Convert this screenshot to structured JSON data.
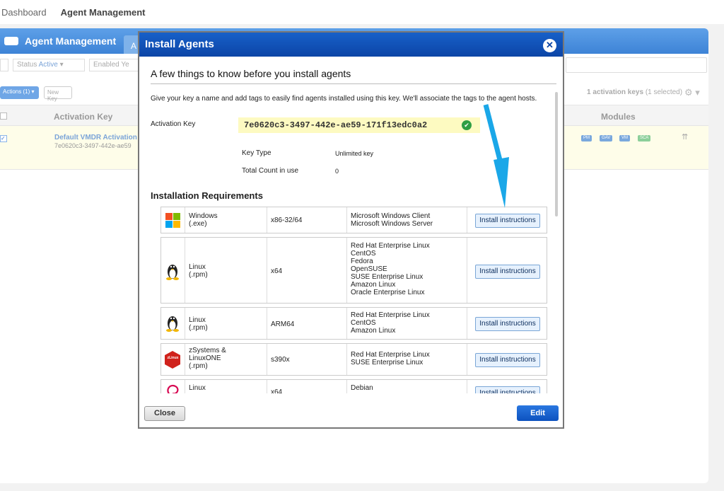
{
  "breadcrumb": {
    "home": "Dashboard",
    "current": "Agent Management"
  },
  "panel": {
    "title": "Agent Management",
    "tab_label": "A",
    "filters": [
      {
        "label": "Status",
        "value": "Active"
      },
      {
        "label": "Enabled",
        "value": "Ye"
      }
    ],
    "actions_label": "Actions (1)",
    "new_key_label": "New Key",
    "count_text": "1 activation keys",
    "count_sub": "(1 selected)",
    "table": {
      "col_activation_key": "Activation Key",
      "col_modules": "Modules",
      "row": {
        "name": "Default VMDR Activation",
        "key": "7e0620c3-3497-442e-ae59",
        "modules": [
          "PM",
          "GAV",
          "VM",
          "SCA"
        ]
      }
    }
  },
  "modal": {
    "title": "Install Agents",
    "subtitle": "A few things to know before you install agents",
    "intro": "Give your key a name and add tags to easily find agents installed using this key. We'll associate the tags to the agent hosts.",
    "activation_key_label": "Activation Key",
    "activation_key_value": "7e0620c3-3497-442e-ae59-171f13edc0a2",
    "key_type_label": "Key Type",
    "key_type_value": "Unlimited key",
    "total_count_label": "Total Count in use",
    "total_count_value": "0",
    "requirements_title": "Installation Requirements",
    "install_button_label": "Install instructions",
    "requirements": [
      {
        "icon": "windows-icon",
        "os": [
          "Windows",
          "(.exe)"
        ],
        "arch": "x86-32/64",
        "distros": [
          "Microsoft Windows Client",
          "Microsoft Windows Server"
        ]
      },
      {
        "icon": "linux-tux-icon",
        "os": [
          "Linux",
          "(.rpm)"
        ],
        "arch": "x64",
        "distros": [
          "Red Hat Enterprise Linux",
          "CentOS",
          "Fedora",
          "OpenSUSE",
          "SUSE Enterprise Linux",
          "Amazon Linux",
          "Oracle Enterprise Linux"
        ]
      },
      {
        "icon": "linux-tux-icon",
        "os": [
          "Linux",
          "(.rpm)"
        ],
        "arch": "ARM64",
        "distros": [
          "Red Hat Enterprise Linux",
          "CentOS",
          "Amazon Linux"
        ]
      },
      {
        "icon": "zlinux-icon",
        "icon_text": "zLinux",
        "os": [
          "zSystems &",
          "LinuxONE",
          "(.rpm)"
        ],
        "arch": "s390x",
        "distros": [
          "Red Hat Enterprise Linux",
          "SUSE Enterprise Linux"
        ]
      },
      {
        "icon": "debian-icon",
        "os": [
          "Linux"
        ],
        "arch": "x64",
        "distros": [
          "Debian"
        ]
      }
    ],
    "close_label": "Close",
    "edit_label": "Edit"
  },
  "colors": {
    "header_blue": "#0c45a6",
    "panel_blue": "#3d83d6",
    "key_highlight": "#fdfac1",
    "annotation_arrow": "#1aa7e8"
  }
}
